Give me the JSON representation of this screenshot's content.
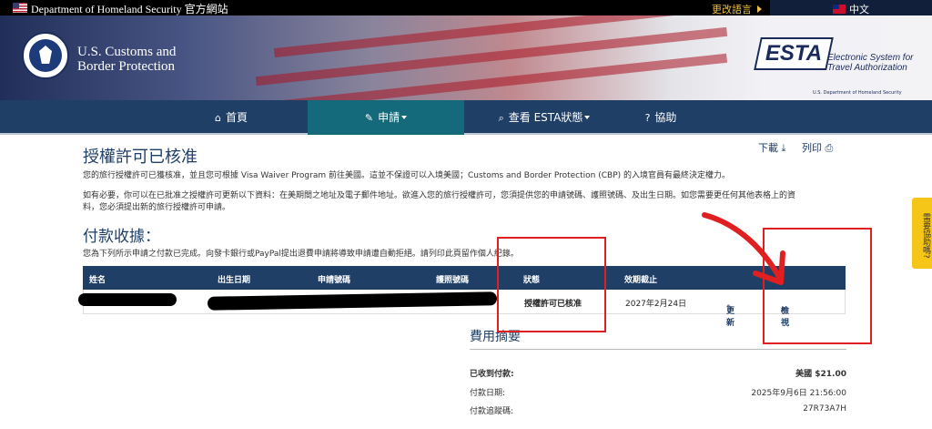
{
  "topbar": {
    "dhs_text": "Department of Homeland Security 官方網站",
    "change_lang": "更改語言",
    "current_lang": "中文"
  },
  "banner": {
    "cbp_line1": "U.S. Customs and",
    "cbp_line2": "Border Protection",
    "esta_logo": "ESTA",
    "esta_line1": "Electronic System for",
    "esta_line2": "Travel Authorization",
    "esta_sub": "U.S. Department of Homeland Security"
  },
  "nav": {
    "home": "首頁",
    "apply": "申請",
    "check_status": "查看 ESTA狀態",
    "help": "協助"
  },
  "page": {
    "title": "授權許可已核准",
    "download": "下載",
    "print": "列印",
    "para1": "您的旅行授權許可已獲核准，並且您可根據 Visa Waiver Program 前往美國。這並不保證可以入境美國；Customs and Border Protection (CBP) 的入境官員有最終決定權力。",
    "para2a": "如有必要，你可以在已批准之授權許可更新以下資料：在美期間之地址及電子郵件地址。欲進入您的旅行授權許可，您須提供您的申請號碼、護照號碼、及出生日期。如您需要更任何其他表格上的資",
    "para2b": "料，您必須提出新的旅行授權許可申請。",
    "receipt_title": "付款收據：",
    "receipt_para": "您為下列所示申請之付款已完成。向發卡銀行或PayPal提出退費申請將導致申請遭自動拒絕。請列印此頁留作個人紀錄。"
  },
  "table": {
    "headers": [
      "姓名",
      "出生日期",
      "申請號碼",
      "護照號碼",
      "狀態",
      "效期截止"
    ],
    "row": {
      "status": "授權許可已核准",
      "expiry": "2027年2月24日",
      "update": "更新",
      "view": "檢視"
    }
  },
  "summary": {
    "title": "費用摘要",
    "received_label": "已收到付款:",
    "received_value": "美國 $21.00",
    "date_label": "付款日期:",
    "date_value": "2025年9月6日 21:56:00",
    "tracking_label": "付款追蹤碼:",
    "tracking_value": "27R73A7H"
  },
  "help_tab": "需要協助嗎?",
  "colors": {
    "nav_bg": "#1f3f67",
    "nav_active": "#14697a",
    "annotation": "#e02020",
    "help_tab": "#f5c518"
  }
}
